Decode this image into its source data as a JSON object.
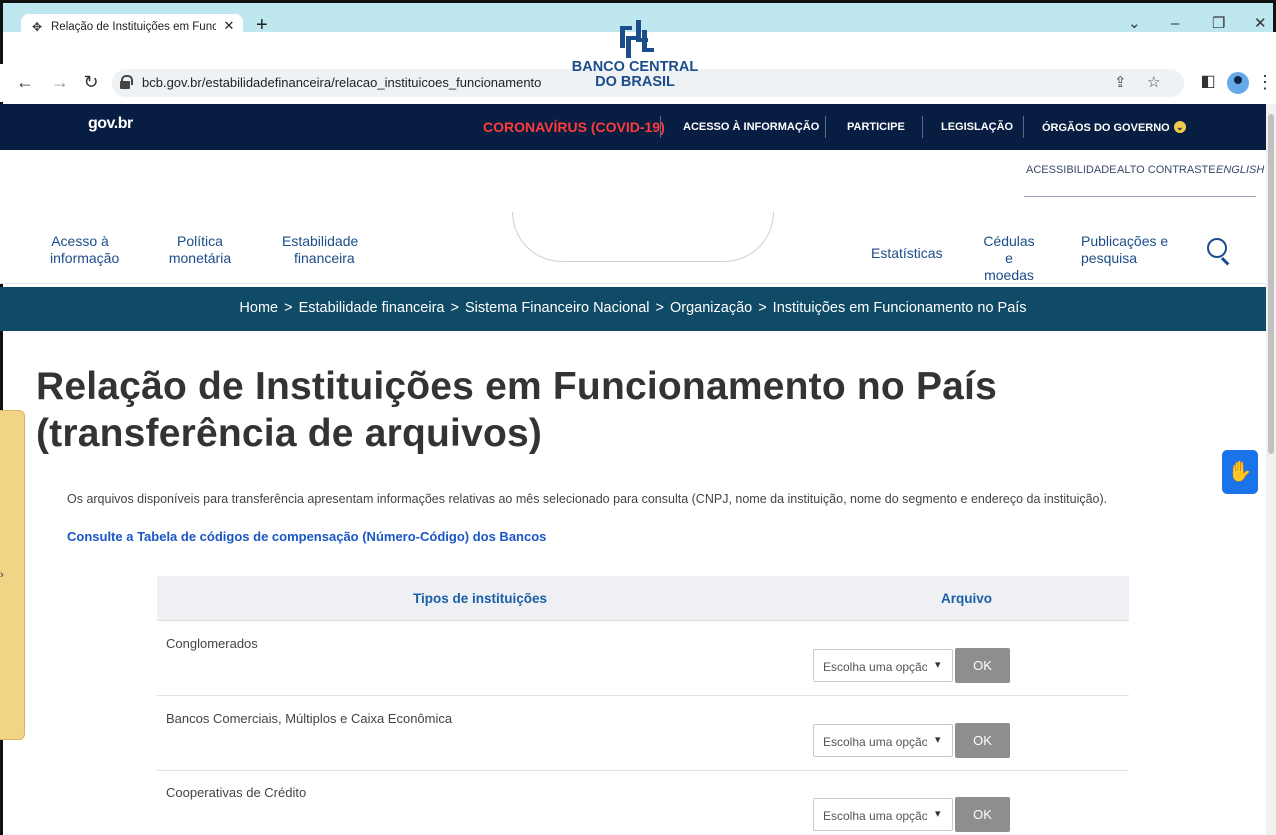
{
  "browser": {
    "tab_title": "Relação de Instituições em Funcio",
    "new_tab": "+",
    "url": "bcb.gov.br/estabilidadefinanceira/relacao_instituicoes_funcionamento"
  },
  "govbar": {
    "logo": "gov.br",
    "links": [
      "CORONAVÍRUS (COVID-19)",
      "ACESSO À INFORMAÇÃO",
      "PARTICIPE",
      "LEGISLAÇÃO",
      "ÓRGÃOS DO GOVERNO"
    ]
  },
  "accessibility": {
    "acessibilidade": "ACESSIBILIDADE",
    "alto_contraste": "ALTO CONTRASTE",
    "english": "ENGLISH"
  },
  "logo": {
    "line1": "BANCO CENTRAL",
    "line2": "DO BRASIL"
  },
  "nav": {
    "items": [
      {
        "line1": "Acesso à",
        "line2": "informação"
      },
      {
        "line1": "Política",
        "line2": "monetária"
      },
      {
        "line1": "Estabilidade",
        "line2": "financeira"
      },
      {
        "line1": "Estatísticas",
        "line2": ""
      },
      {
        "line1": "Cédulas e",
        "line2": "moedas"
      },
      {
        "line1": "Publicações e",
        "line2": "pesquisa"
      }
    ]
  },
  "breadcrumb": [
    "Home",
    "Estabilidade financeira",
    "Sistema Financeiro Nacional",
    "Organização",
    "Instituições em Funcionamento no País"
  ],
  "breadcrumb_separator": ">",
  "main": {
    "title": "Relação de Instituições em Funcionamento no País (transferência de arquivos)",
    "intro": "Os arquivos disponíveis para transferência apresentam informações relativas ao mês selecionado para consulta (CNPJ, nome da instituição, nome do segmento e endereço da instituição).",
    "codes_link": "Consulte a Tabela de códigos de compensação (Número-Código) dos Bancos"
  },
  "table": {
    "headers": [
      "Tipos de instituições",
      "Arquivo"
    ],
    "rows": [
      {
        "label": "Conglomerados",
        "select": "Escolha uma opção",
        "button": "OK"
      },
      {
        "label": "Bancos Comerciais, Múltiplos e Caixa Econômica",
        "select": "Escolha uma opção",
        "button": "OK"
      },
      {
        "label": "Cooperativas de Crédito",
        "select": "Escolha uma opção",
        "button": "OK"
      }
    ]
  },
  "colors": {
    "govbar_bg": "#071d41",
    "breadcrumb_bg": "#0f4a66",
    "accent_blue": "#1b4d8a",
    "link_blue": "#1a56c4",
    "covid_red": "#ff3b3b"
  }
}
